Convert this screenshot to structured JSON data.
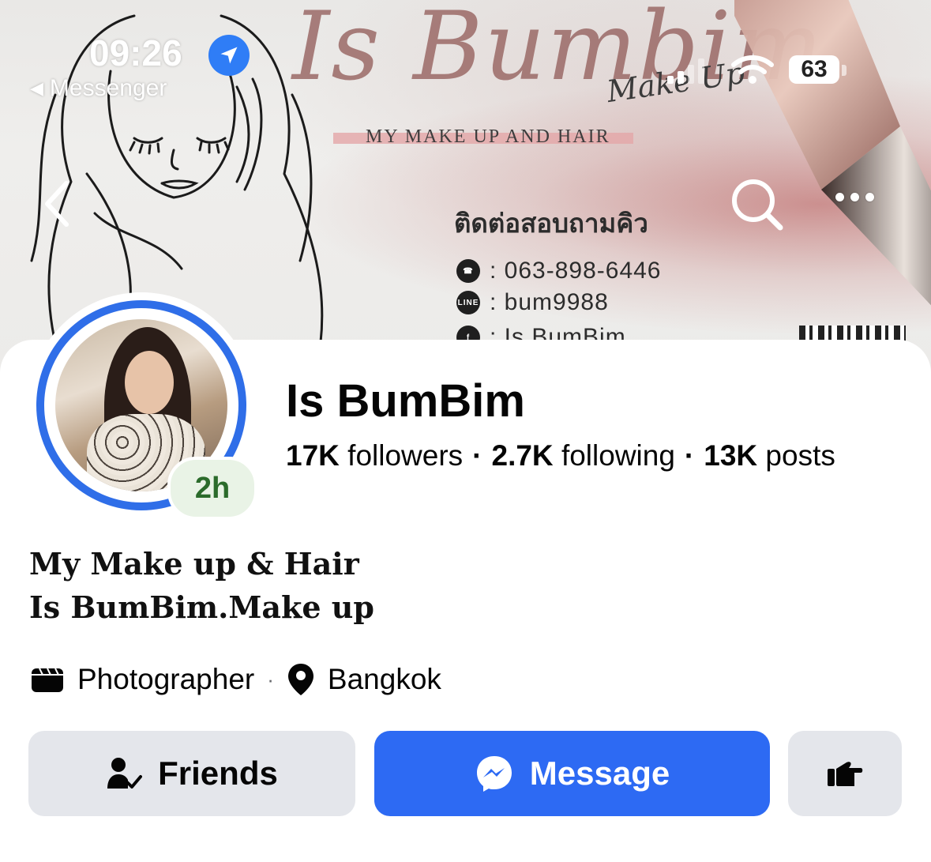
{
  "status_bar": {
    "time": "09:26",
    "back_app": "Messenger",
    "battery": "63"
  },
  "cover": {
    "script_title": "Is Bumbim",
    "script_subtitle": "Make Up",
    "tagline": "MY MAKE UP AND HAIR",
    "contact_title": "ติดต่อสอบถามคิว",
    "phone": ": 063-898-6446",
    "line_id": ": bum9988",
    "facebook": ": Is BumBim",
    "line_badge": "LINE"
  },
  "profile": {
    "name": "Is BumBim",
    "story_age": "2h",
    "followers_count": "17K",
    "followers_label": "followers",
    "following_count": "2.7K",
    "following_label": "following",
    "posts_count": "13K",
    "posts_label": "posts",
    "bio_line1": "My Make up & Hair",
    "bio_line2": "Is BumBim.Make up",
    "category": "Photographer",
    "location": "Bangkok"
  },
  "actions": {
    "friends_label": "Friends",
    "message_label": "Message"
  },
  "colors": {
    "accent": "#2d6af3",
    "button_gray": "#e4e6eb",
    "story_badge": "#e9f3e6"
  }
}
